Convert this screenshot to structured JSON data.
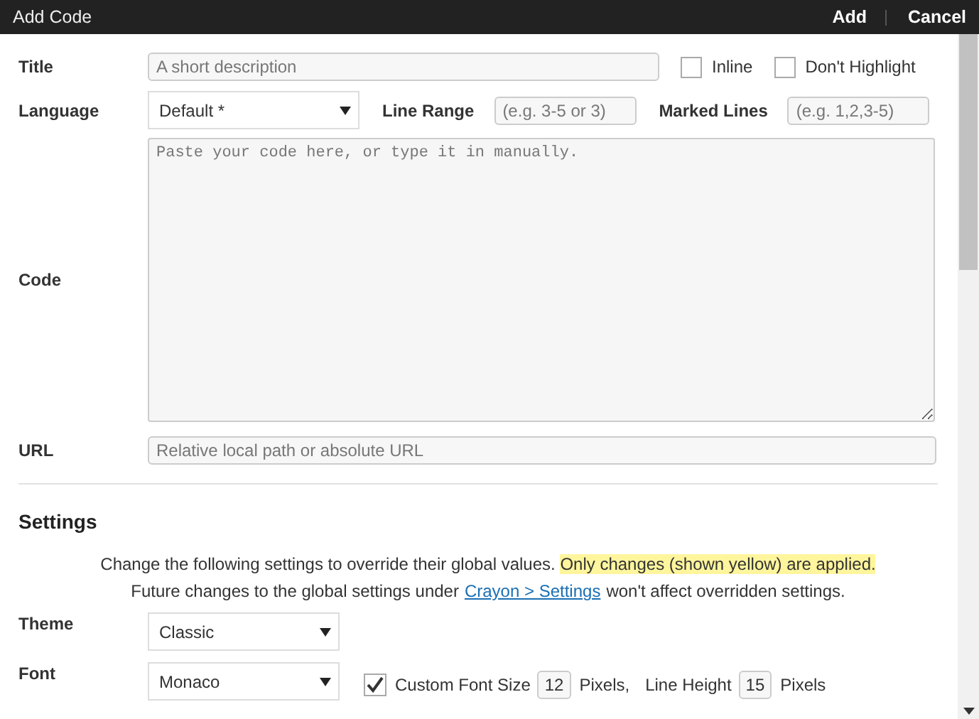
{
  "window": {
    "title": "Add Code",
    "actions": [
      "Add",
      "Cancel"
    ]
  },
  "form": {
    "title": {
      "label": "Title",
      "placeholder": "A short description"
    },
    "toggles": [
      {
        "label": "Inline",
        "checked": false
      },
      {
        "label": "Don't Highlight",
        "checked": false
      }
    ],
    "language": {
      "label": "Language",
      "value": "Default *"
    },
    "line_range": {
      "label": "Line Range",
      "placeholder": "(e.g. 3-5 or 3)"
    },
    "marked_lines": {
      "label": "Marked Lines",
      "placeholder": "(e.g. 1,2,3-5)"
    },
    "code": {
      "label": "Code",
      "placeholder": "Paste your code here, or type it in manually."
    },
    "url": {
      "label": "URL",
      "placeholder": "Relative local path or absolute URL"
    }
  },
  "settings": {
    "heading": "Settings",
    "note_1": {
      "text": "Change the following settings to override their global values.",
      "highlight": "Only changes (shown yellow) are applied."
    },
    "note_2": {
      "before": "Future changes to the global settings under",
      "link": "Crayon > Settings",
      "after": "won't affect overridden settings."
    },
    "theme": {
      "label": "Theme",
      "value": "Classic"
    },
    "font": {
      "label": "Font",
      "value": "Monaco"
    },
    "custom_font_size": {
      "checked": true,
      "label": "Custom Font Size",
      "value": "12",
      "unit": "Pixels,"
    },
    "line_height": {
      "label": "Line Height",
      "value": "15",
      "unit": "Pixels"
    }
  }
}
